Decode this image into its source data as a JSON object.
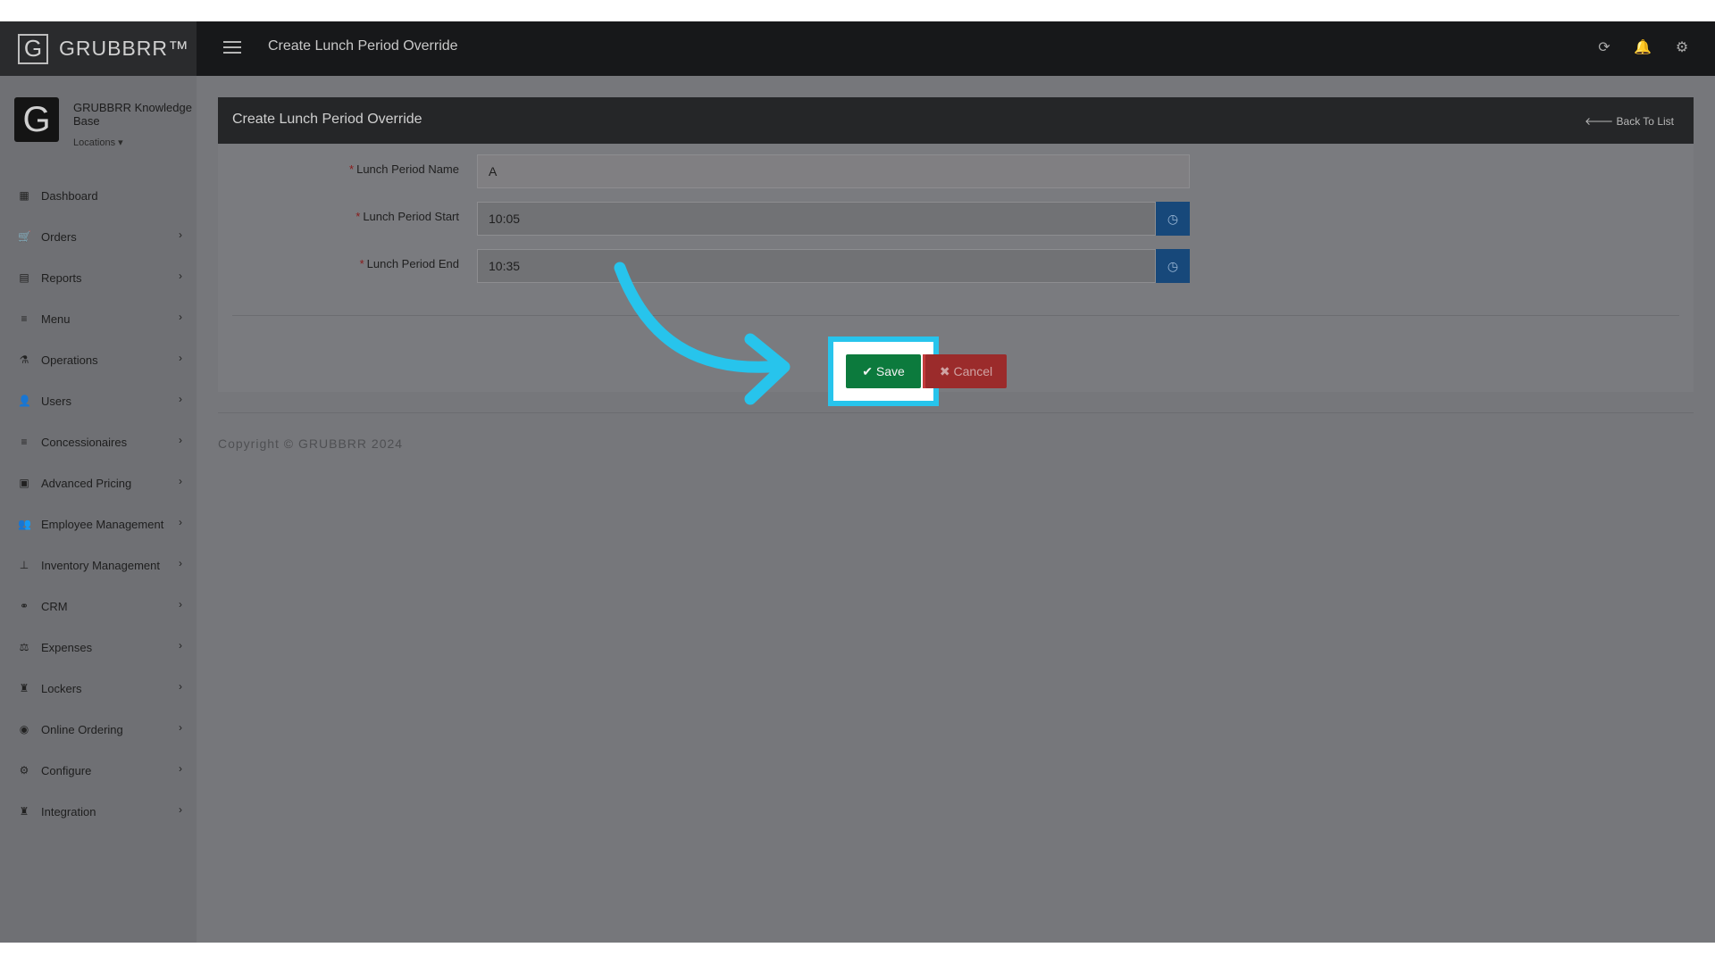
{
  "app": {
    "brand": "GRUBBRR™",
    "brand_initial": "G"
  },
  "topbar": {
    "title": "Create Lunch Period Override",
    "icons": [
      "refresh-icon",
      "bell-icon",
      "gear-icon"
    ]
  },
  "profile": {
    "initial": "G",
    "name": "GRUBBRR Knowledge Base",
    "locations": "Locations ▾"
  },
  "sidebar": {
    "items": [
      {
        "label": "Dashboard",
        "icon": "dashboard-icon",
        "glyph": "▦",
        "chevron": ""
      },
      {
        "label": "Orders",
        "icon": "cart-icon",
        "glyph": "🛒",
        "chevron": "›"
      },
      {
        "label": "Reports",
        "icon": "report-icon",
        "glyph": "▤",
        "chevron": "›"
      },
      {
        "label": "Menu",
        "icon": "list-icon",
        "glyph": "≡",
        "chevron": "›"
      },
      {
        "label": "Operations",
        "icon": "flask-icon",
        "glyph": "⚗",
        "chevron": "›"
      },
      {
        "label": "Users",
        "icon": "add-user-icon",
        "glyph": "👤",
        "chevron": "›"
      },
      {
        "label": "Concessionaires",
        "icon": "list-icon",
        "glyph": "≡",
        "chevron": "›"
      },
      {
        "label": "Advanced Pricing",
        "icon": "money-icon",
        "glyph": "▣",
        "chevron": "›"
      },
      {
        "label": "Employee Management",
        "icon": "users-icon",
        "glyph": "👥",
        "chevron": "›"
      },
      {
        "label": "Inventory Management",
        "icon": "sitemap-icon",
        "glyph": "⊥",
        "chevron": "›"
      },
      {
        "label": "CRM",
        "icon": "link-icon",
        "glyph": "⚭",
        "chevron": "›"
      },
      {
        "label": "Expenses",
        "icon": "balance-icon",
        "glyph": "⚖",
        "chevron": "›"
      },
      {
        "label": "Lockers",
        "icon": "locker-icon",
        "glyph": "♜",
        "chevron": "›"
      },
      {
        "label": "Online Ordering",
        "icon": "globe-icon",
        "glyph": "◉",
        "chevron": "›"
      },
      {
        "label": "Configure",
        "icon": "cog-icon",
        "glyph": "⚙",
        "chevron": "›"
      },
      {
        "label": "Integration",
        "icon": "plug-icon",
        "glyph": "♜",
        "chevron": "›"
      }
    ]
  },
  "panel": {
    "title": "Create Lunch Period Override",
    "back_link": "🡐 Back To List",
    "fields": {
      "name": {
        "label": "Lunch Period Name",
        "value": "A"
      },
      "start": {
        "label": "Lunch Period Start",
        "value": "10:05"
      },
      "end": {
        "label": "Lunch Period End",
        "value": "10:35"
      }
    },
    "required_mark": "*",
    "save": "✔ Save",
    "cancel": "✖ Cancel"
  },
  "footer": {
    "copyright": "Copyright © GRUBBRR 2024"
  },
  "colors": {
    "highlight": "#27c4ec",
    "save": "#0c7a3d",
    "cancel": "#9b2b2b",
    "clock": "#17487a"
  }
}
